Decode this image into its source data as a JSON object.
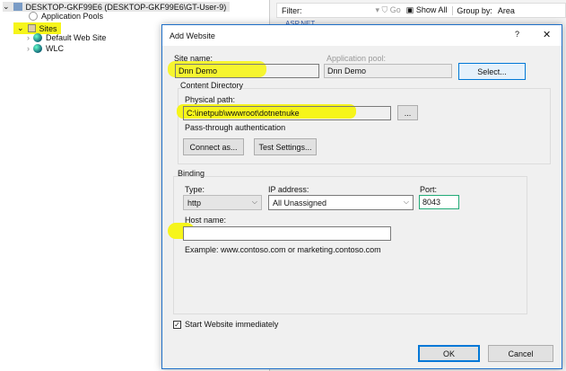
{
  "tree": {
    "server": "DESKTOP-GKF99E6 (DESKTOP-GKF99E6\\GT-User-9)",
    "app_pools": "Application Pools",
    "sites": "Sites",
    "site_items": [
      "Default Web Site",
      "WLC"
    ]
  },
  "right_pane": {
    "filter_label": "Filter:",
    "go_label": "Go",
    "show_all": "Show All",
    "group_by_label": "Group by:",
    "group_by_value": "Area",
    "partial_row": "ASP.NET"
  },
  "dialog": {
    "title": "Add Website",
    "help": "?",
    "close": "✕",
    "site_name_label": "Site name:",
    "site_name_value": "Dnn Demo",
    "app_pool_label": "Application pool:",
    "app_pool_value": "Dnn Demo",
    "select_button": "Select...",
    "content_dir_label": "Content Directory",
    "physical_path_label": "Physical path:",
    "physical_path_value": "C:\\inetpub\\wwwroot\\dotnetnuke",
    "browse_button": "...",
    "pass_through_label": "Pass-through authentication",
    "connect_as_button": "Connect as...",
    "test_settings_button": "Test Settings...",
    "binding_label": "Binding",
    "type_label": "Type:",
    "type_value": "http",
    "ip_label": "IP address:",
    "ip_value": "All Unassigned",
    "port_label": "Port:",
    "port_value": "8043",
    "host_label": "Host name:",
    "host_value": "",
    "example": "Example: www.contoso.com or marketing.contoso.com",
    "start_label": "Start Website immediately",
    "start_checked": true,
    "ok_button": "OK",
    "cancel_button": "Cancel"
  }
}
